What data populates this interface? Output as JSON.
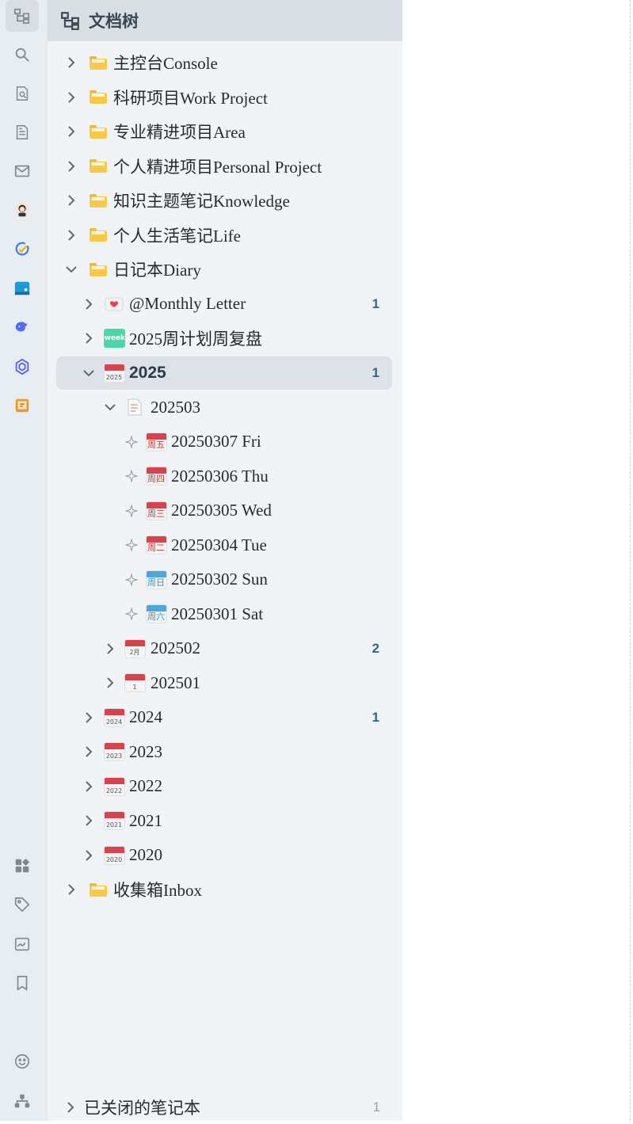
{
  "panel": {
    "title": "文档树"
  },
  "rail": {
    "top": [
      "doc-tree-icon",
      "search-icon",
      "find-doc-icon",
      "file-icon",
      "mail-icon",
      "avatar-plugin-icon",
      "check-plugin-icon",
      "chat-plugin-icon",
      "deepseek-plugin-icon",
      "openai-plugin-icon",
      "note-plugin-icon"
    ],
    "bottom": [
      "widgets-icon",
      "tag-icon",
      "handwriting-icon",
      "bookmark-icon",
      "smiley-icon",
      "graph-icon"
    ]
  },
  "tree": [
    {
      "label": "主控台Console",
      "icon": "folder",
      "level": 0,
      "expanded": false
    },
    {
      "label": "科研项目Work Project",
      "icon": "folder",
      "level": 0,
      "expanded": false
    },
    {
      "label": "专业精进项目Area",
      "icon": "folder",
      "level": 0,
      "expanded": false
    },
    {
      "label": "个人精进项目Personal Project",
      "icon": "folder",
      "level": 0,
      "expanded": false
    },
    {
      "label": "知识主题笔记Knowledge",
      "icon": "folder",
      "level": 0,
      "expanded": false
    },
    {
      "label": "个人生活笔记Life",
      "icon": "folder",
      "level": 0,
      "expanded": false
    },
    {
      "label": "日记本Diary",
      "icon": "folder",
      "level": 0,
      "expanded": true
    },
    {
      "label": "@Monthly Letter",
      "icon": "love-letter",
      "level": 1,
      "expanded": false,
      "count": "1"
    },
    {
      "label": "2025周计划周复盘",
      "icon": "week",
      "icon_text": "week",
      "level": 1,
      "expanded": false
    },
    {
      "label": "2025",
      "icon": "calendar",
      "icon_text": "2025",
      "level": 1,
      "expanded": true,
      "count": "1",
      "selected": true
    },
    {
      "label": "202503",
      "icon": "page",
      "level": 2,
      "expanded": true
    },
    {
      "label": "20250307 Fri",
      "icon": "day",
      "icon_text": "周五",
      "level": 3,
      "leaf": true
    },
    {
      "label": "20250306 Thu",
      "icon": "day",
      "icon_text": "周四",
      "level": 3,
      "leaf": true
    },
    {
      "label": "20250305 Wed",
      "icon": "day",
      "icon_text": "周三",
      "level": 3,
      "leaf": true
    },
    {
      "label": "20250304 Tue",
      "icon": "day",
      "icon_text": "周二",
      "level": 3,
      "leaf": true
    },
    {
      "label": "20250302 Sun",
      "icon": "day-blue",
      "icon_text": "周日",
      "level": 3,
      "leaf": true
    },
    {
      "label": "20250301 Sat",
      "icon": "day-blue",
      "icon_text": "周六",
      "level": 3,
      "leaf": true
    },
    {
      "label": "202502",
      "icon": "calendar",
      "icon_text": "2月",
      "level": 2,
      "expanded": false,
      "count": "2"
    },
    {
      "label": "202501",
      "icon": "calendar",
      "icon_text": "1",
      "level": 2,
      "expanded": false
    },
    {
      "label": "2024",
      "icon": "calendar",
      "icon_text": "2024",
      "level": 1,
      "expanded": false,
      "count": "1"
    },
    {
      "label": "2023",
      "icon": "calendar",
      "icon_text": "2023",
      "level": 1,
      "expanded": false
    },
    {
      "label": "2022",
      "icon": "calendar",
      "icon_text": "2022",
      "level": 1,
      "expanded": false
    },
    {
      "label": "2021",
      "icon": "calendar",
      "icon_text": "2021",
      "level": 1,
      "expanded": false
    },
    {
      "label": "2020",
      "icon": "calendar",
      "icon_text": "2020",
      "level": 1,
      "expanded": false
    },
    {
      "label": "收集箱Inbox",
      "icon": "folder",
      "level": 0,
      "expanded": false
    }
  ],
  "footer": {
    "label": "已关闭的笔记本",
    "count": "1"
  }
}
